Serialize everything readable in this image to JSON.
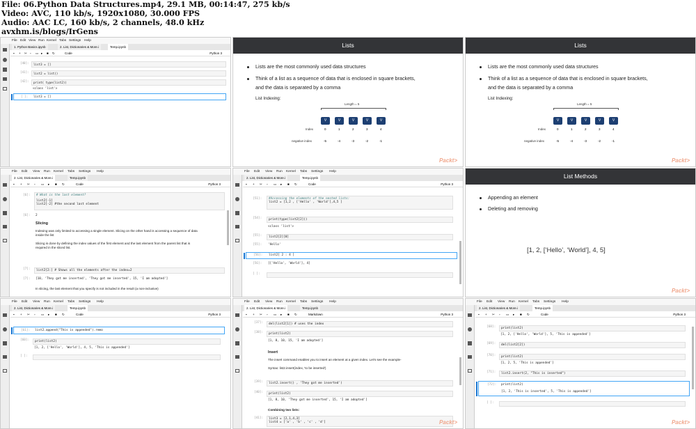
{
  "header": {
    "lines": [
      "File: 06.Python Data Structures.mp4, 29.1 MB, 00:14:47, 275 kb/s",
      "Video: AVC, 110 kb/s, 1920x1080, 30.000 FPS",
      "Audio: AAC LC, 160 kb/s, 2 channels, 48.0 kHz",
      "avxhm.is/blogs/IrGens"
    ]
  },
  "menu": [
    "File",
    "Edit",
    "View",
    "Run",
    "Kernel",
    "Tabs",
    "Settings",
    "Help"
  ],
  "brand": "Packt>",
  "tabs_a": [
    "1. Python Basics.ipynb",
    "2. List, Dictionaries & More.i",
    "Temp.ipynb"
  ],
  "tabs_b": [
    "2. List, Dictionaries & More.i",
    "Temp.ipynb"
  ],
  "kernel": "Python 3",
  "celltype": {
    "code": "Code",
    "markdown": "Markdown"
  },
  "slide_lists": {
    "title": "Lists",
    "b1": "Lists are the most commonly used data structures",
    "b2a": "Think of a list as a sequence of data that is enclosed in square brackets,",
    "b2b": "and the data is separated by a comma",
    "indexing": "List Indexing:",
    "length": "Length = 5",
    "cell": "V",
    "index_label": "Index",
    "index": [
      "0",
      "1",
      "2",
      "3",
      "4"
    ],
    "neg_label": "negative index",
    "neg": [
      "-5",
      "-4",
      "-3",
      "-2",
      "-1"
    ]
  },
  "slide_methods": {
    "title": "List Methods",
    "b1": "Appending an element",
    "b2": "Deleting and removing",
    "example": "[1, 2, [‘Hello’, ‘World’], 4, 5]"
  },
  "f1": {
    "p1": "[40]:",
    "c1": "list3 = []",
    "p2": "[41]:",
    "c2": "list2 = list()",
    "p3": "[42]:",
    "c3": "print( type(list2))",
    "o3": "<class 'list'>",
    "p4": "[ ]:",
    "c4": "list3 = []"
  },
  "f4": {
    "p1": "[6]:",
    "c1": "# What is the last element?",
    "c2": "list2[-1]",
    "c3": "list2[-2] #the second last element",
    "o1": "[6]:",
    "o1v": "2",
    "h1": "Slicing",
    "m1": "Indexing was only limited to accessing a single element. Slicing on the other hand is accessing a sequence of data",
    "m1b": "inside the list",
    "m2": "Slicing is done by defining the index values of the first element and the last element from the parent list that is",
    "m2b": "required in the sliced list.",
    "p2": "[7]:",
    "c4": "list2[2:]  # Shows all the elements after the index=2",
    "o2": "[7]:",
    "o2v": "[10, 'They got me inserted', 'They got me inserted', 15, 'I am adopted']",
    "m3": "In slicing, the last element that you specify is not included in the result (a non-inclusive)"
  },
  "f5": {
    "p1": "[51]:",
    "c1": "#Accessing the elements of the nested lists:",
    "c2": "list2 = [1,2 , ['Hello' , 'World'],4,5 ]",
    "p2": "[54]:",
    "c3": "print(type(list2[2]))",
    "o1": "<class 'list'>",
    "p3": "[55]:",
    "c4": "list2[2][0]",
    "o2": "[55]:",
    "o2v": "'Hello'",
    "p4": "[56]:",
    "c5": "list2[ 2 : 4 ]",
    "o3": "[56]:",
    "o3v": "[['Hello', 'World'], 4]",
    "p5": "[ ]:"
  },
  "f7": {
    "p1": "[61]:",
    "c1": "list2.append(\"This is appended\").remo",
    "p2": "[60]:",
    "c2": "print(list2)",
    "o1": "[1, 2, ['Hello', 'World'], 4, 5, 'This is appended']",
    "p3": "[ ]:"
  },
  "f8": {
    "p1": "[37]:",
    "c1": "del(list2[1]) # uses the index",
    "p2": "[38]:",
    "c2": "print(list2)",
    "o1": "[1, 8, 10, 15, 'I am adopted']",
    "h1": "Insert",
    "m1": "The insert command enables you to insert an element at a given index. Let's see the example-",
    "m2": "Syntax: list2.insert(index, 'to be inserted')",
    "p3": "[39]:",
    "c3": "list2.insert() , 'They got me inserted')",
    "p4": "[40]:",
    "c4": "print(list2)",
    "o2": "[1, 8, 10, 'They got me inserted', 15, 'I am adopted']",
    "h2": "Combining two lists:",
    "p5": "[41]:",
    "c5": "list3 = [2,1,4,3]",
    "c6": "list4 = ['a' , 'b' , 'c' , 'd']"
  },
  "f9": {
    "p1": "[68]:",
    "c1": "print(list2)",
    "o1": "[1, 2, ['Hello', 'World'], 5, 'This is appended']",
    "p2": "[69]:",
    "c2": "del(list2[2])",
    "p3": "[70]:",
    "c3": "print(list2)",
    "o2": "[1, 2, 5, 'This is appended']",
    "p4": "[71]:",
    "c4": "list2.insert(2, \"This is inserted\")",
    "p5": "[72]:",
    "c5": "print(list2)",
    "o3": "[1, 2, 'This is inserted', 5, 'This is appended']",
    "p6": "[ ]:"
  }
}
